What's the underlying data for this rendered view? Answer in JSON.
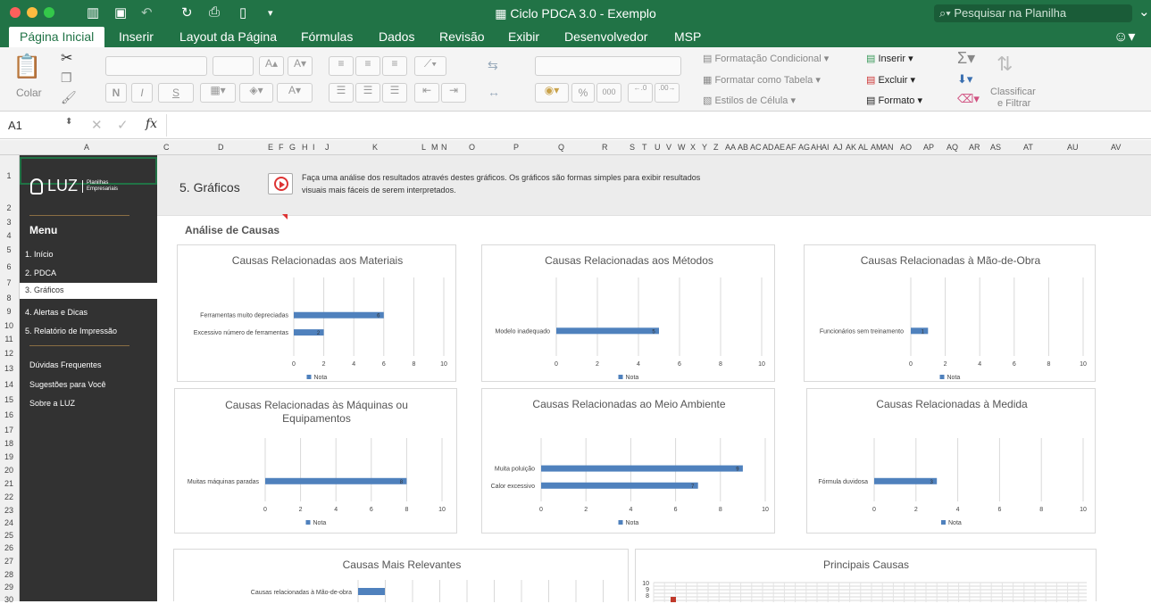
{
  "window": {
    "title": "Ciclo PDCA 3.0 - Exemplo",
    "search_placeholder": "Pesquisar na Planilha"
  },
  "ribbon_tabs": [
    "Página Inicial",
    "Inserir",
    "Layout da Página",
    "Fórmulas",
    "Dados",
    "Revisão",
    "Exibir",
    "Desenvolvedor",
    "MSP"
  ],
  "ribbon": {
    "paste": "Colar",
    "bold": "N",
    "italic": "I",
    "underline": "S",
    "cond_format": "Formatação Condicional",
    "format_table": "Formatar como Tabela",
    "cell_styles": "Estilos de Célula",
    "insert": "Inserir",
    "delete": "Excluir",
    "format": "Formato",
    "sort_filter_1": "Classificar",
    "sort_filter_2": "e Filtrar",
    "percent": "%",
    "thousands": "000"
  },
  "formula": {
    "cell_ref": "A1",
    "fx": "fx"
  },
  "columns": [
    "A",
    "C",
    "D",
    "E",
    "F",
    "G",
    "H",
    "I",
    "J",
    "K",
    "L",
    "M",
    "N",
    "O",
    "P",
    "Q",
    "R",
    "S",
    "T",
    "U",
    "V",
    "W",
    "X",
    "Y",
    "Z",
    "AA",
    "AB",
    "AC",
    "AD",
    "AE",
    "AF",
    "AG",
    "AH",
    "AI",
    "AJ",
    "AK",
    "AL",
    "AM",
    "AN",
    "AO",
    "AP",
    "AQ",
    "AR",
    "AS",
    "AT",
    "AU",
    "AV"
  ],
  "rows": [
    "1",
    "2",
    "3",
    "4",
    "5",
    "6",
    "7",
    "8",
    "9",
    "10",
    "11",
    "12",
    "13",
    "14",
    "15",
    "16",
    "17",
    "18",
    "19",
    "20",
    "21",
    "22",
    "23",
    "24",
    "25",
    "26",
    "27",
    "28",
    "29",
    "30"
  ],
  "sidebar": {
    "logo_text": "LUZ",
    "logo_sub1": "Planilhas",
    "logo_sub2": "Empresariais",
    "menu_title": "Menu",
    "items": [
      "1. Início",
      "2. PDCA",
      "3. Gráficos",
      "4. Alertas e Dicas",
      "5. Relatório de Impressão"
    ],
    "extra": [
      "Dúvidas Frequentes",
      "Sugestões para Você",
      "Sobre a LUZ"
    ]
  },
  "banner": {
    "title": "5. Gráficos",
    "desc_line1": "Faça uma análise dos resultados através destes gráficos. Os gráficos são formas simples para exibir resultados",
    "desc_line2": "visuais mais fáceis de serem interpretados."
  },
  "section_title": "Análise de Causas",
  "colors": {
    "excel_green": "#217346",
    "bar": "#4f81bd",
    "sidebar": "#323232"
  },
  "chart_data": [
    {
      "type": "bar",
      "title": "Causas Relacionadas aos Materiais",
      "categories": [
        "Ferramentas muito depreciadas",
        "Excessivo número de ferramentas"
      ],
      "series": [
        {
          "name": "Nota",
          "values": [
            6,
            2
          ]
        }
      ],
      "xlim": [
        0,
        10
      ],
      "ticks": [
        "0",
        "2",
        "4",
        "6",
        "8",
        "10"
      ],
      "legend": "bottom"
    },
    {
      "type": "bar",
      "title": "Causas Relacionadas aos Métodos",
      "categories": [
        "Modelo inadequado"
      ],
      "series": [
        {
          "name": "Nota",
          "values": [
            5
          ]
        }
      ],
      "xlim": [
        0,
        10
      ],
      "ticks": [
        "0",
        "2",
        "4",
        "6",
        "8",
        "10"
      ],
      "legend": "bottom"
    },
    {
      "type": "bar",
      "title": "Causas Relacionadas à Mão-de-Obra",
      "categories": [
        "Funcionários sem treinamento"
      ],
      "series": [
        {
          "name": "Nota",
          "values": [
            1
          ]
        }
      ],
      "xlim": [
        0,
        10
      ],
      "ticks": [
        "0",
        "2",
        "4",
        "6",
        "8",
        "10"
      ],
      "legend": "bottom"
    },
    {
      "type": "bar",
      "title": "Causas Relacionadas às Máquinas ou Equipamentos",
      "categories": [
        "Muitas máquinas paradas"
      ],
      "series": [
        {
          "name": "Nota",
          "values": [
            8
          ]
        }
      ],
      "xlim": [
        0,
        10
      ],
      "ticks": [
        "0",
        "2",
        "4",
        "6",
        "8",
        "10"
      ],
      "legend": "bottom"
    },
    {
      "type": "bar",
      "title": "Causas Relacionadas ao Meio Ambiente",
      "categories": [
        "Muita poluição",
        "Calor excessivo"
      ],
      "series": [
        {
          "name": "Nota",
          "values": [
            9,
            7
          ]
        }
      ],
      "xlim": [
        0,
        10
      ],
      "ticks": [
        "0",
        "2",
        "4",
        "6",
        "8",
        "10"
      ],
      "legend": "bottom"
    },
    {
      "type": "bar",
      "title": "Causas Relacionadas à Medida",
      "categories": [
        "Fórmula duvidosa"
      ],
      "series": [
        {
          "name": "Nota",
          "values": [
            3
          ]
        }
      ],
      "xlim": [
        0,
        10
      ],
      "ticks": [
        "0",
        "2",
        "4",
        "6",
        "8",
        "10"
      ],
      "legend": "bottom"
    },
    {
      "type": "bar",
      "title": "Causas Mais Relevantes",
      "categories": [
        "Causas relacionadas à Mão-de-obra"
      ],
      "series": [
        {
          "name": "",
          "values": [
            1
          ]
        }
      ]
    },
    {
      "type": "scatter",
      "title": "Principais Causas",
      "yticks": [
        "10",
        "9",
        "8"
      ]
    }
  ]
}
